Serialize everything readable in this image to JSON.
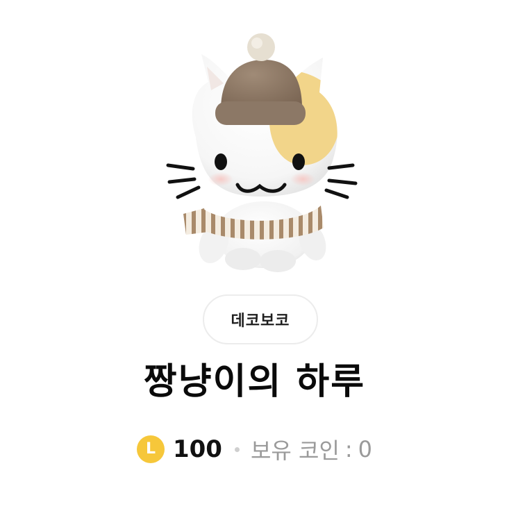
{
  "creator": {
    "label": "데코보코"
  },
  "title": "짱냥이의 하루",
  "price": {
    "coin_icon_letter": "L",
    "value": "100",
    "owned_label": "보유 코인",
    "owned_separator": ":",
    "owned_value": "0"
  },
  "colors": {
    "coin": "#f6c73a",
    "hat": "#8c7866",
    "pompom": "#e6dfd1",
    "ear_patch": "#f2d58a",
    "scarf_stripe": "#a98a6a"
  },
  "icons": {
    "sticker": "cat-character-sticker",
    "coin": "coin-icon"
  }
}
